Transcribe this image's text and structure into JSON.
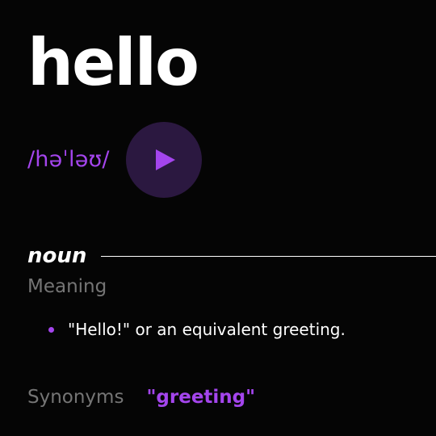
{
  "word": {
    "text": "hello",
    "phonetic": "/həˈləʊ/"
  },
  "audio": {
    "icon": "play-icon"
  },
  "meaning": {
    "part_of_speech": "noun",
    "label": "Meaning",
    "definitions": [
      "\"Hello!\" or an equivalent greeting."
    ]
  },
  "synonyms": {
    "label": "Synonyms",
    "items": [
      "\"greeting\""
    ]
  },
  "colors": {
    "background": "#050505",
    "accent": "#a445ed",
    "muted_text": "#757575",
    "play_button_background": "#2b1840"
  }
}
